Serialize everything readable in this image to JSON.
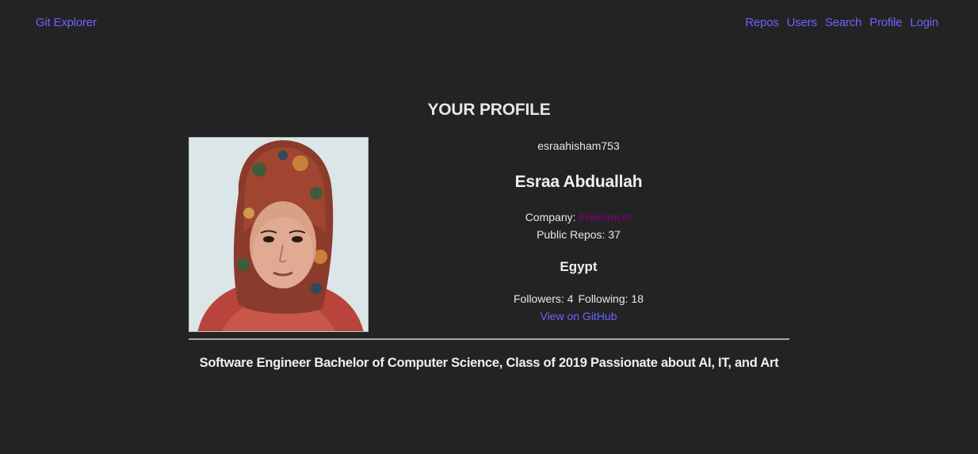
{
  "nav": {
    "brand": "Git Explorer",
    "links": [
      "Repos",
      "Users",
      "Search",
      "Profile",
      "Login"
    ]
  },
  "profile": {
    "title": "YOUR PROFILE",
    "username": "esraahisham753",
    "name": "Esraa Abduallah",
    "company_label": "Company: ",
    "company": "Freelancer",
    "public_repos_label": "Public Repos: ",
    "public_repos": "37",
    "location": "Egypt",
    "followers_label": "Followers: ",
    "followers": "4",
    "following_label": "Following: ",
    "following": "18",
    "github_link": "View on GitHub",
    "bio": "Software Engineer Bachelor of Computer Science, Class of 2019 Passionate about AI, IT, and Art"
  },
  "colors": {
    "background": "#232323",
    "link": "#6c63ff",
    "company": "#800080"
  }
}
